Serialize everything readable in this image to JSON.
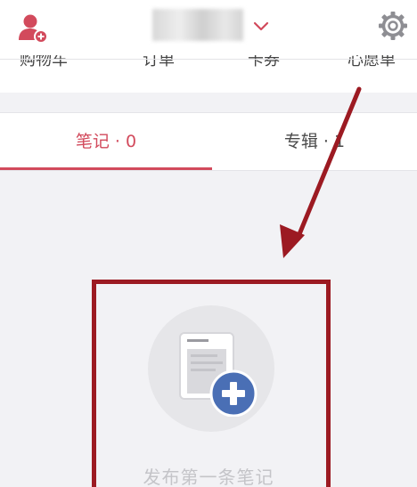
{
  "colors": {
    "accent": "#d24a5c",
    "annotation": "#9c1a22",
    "background": "#f2f2f5",
    "plus_badge": "#4a6fb5"
  },
  "header": {
    "add_user_icon": "add-user-icon",
    "username_chevron_icon": "chevron-down-icon",
    "settings_icon": "gear-icon"
  },
  "quicknav": {
    "items": [
      "购物车",
      "订单",
      "卡券",
      "心愿单"
    ]
  },
  "tabs": [
    {
      "label": "笔记 · 0",
      "active": true
    },
    {
      "label": "专辑 · 1",
      "active": false
    }
  ],
  "empty_state": {
    "icon": "new-note-icon",
    "text": "发布第一条笔记"
  }
}
